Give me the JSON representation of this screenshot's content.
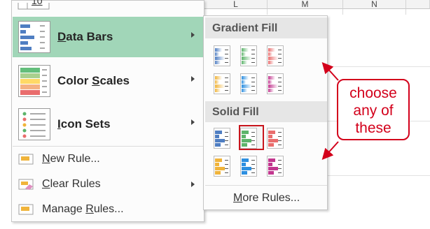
{
  "sheet": {
    "columns": [
      "L",
      "M",
      "N"
    ]
  },
  "menu": {
    "top_partial_label": "10",
    "items": [
      {
        "label": "Data Bars",
        "accel": "D",
        "icon": "data-bars-icon",
        "has_submenu": true,
        "active": true
      },
      {
        "label": "Color Scales",
        "accel": "S",
        "icon": "color-scales-icon",
        "has_submenu": true
      },
      {
        "label": "Icon Sets",
        "accel": "I",
        "icon": "icon-sets-icon",
        "has_submenu": true
      }
    ],
    "rules": [
      {
        "label": "New Rule...",
        "accel": "N",
        "icon": "new-rule-icon"
      },
      {
        "label": "Clear Rules",
        "accel": "C",
        "icon": "eraser-icon",
        "has_submenu": true
      },
      {
        "label": "Manage Rules...",
        "accel": "R",
        "icon": "manage-rules-icon"
      }
    ]
  },
  "submenu": {
    "gradient_title": "Gradient Fill",
    "solid_title": "Solid Fill",
    "more_label": "More Rules...",
    "colors": [
      "#4f7ec2",
      "#5db46b",
      "#e96d6d",
      "#f0b43b",
      "#2d8fe0",
      "#c2378f"
    ],
    "selected": "solid-green"
  },
  "callout": {
    "lines": [
      "choose",
      "any of",
      "these"
    ],
    "color": "#d3001b"
  }
}
